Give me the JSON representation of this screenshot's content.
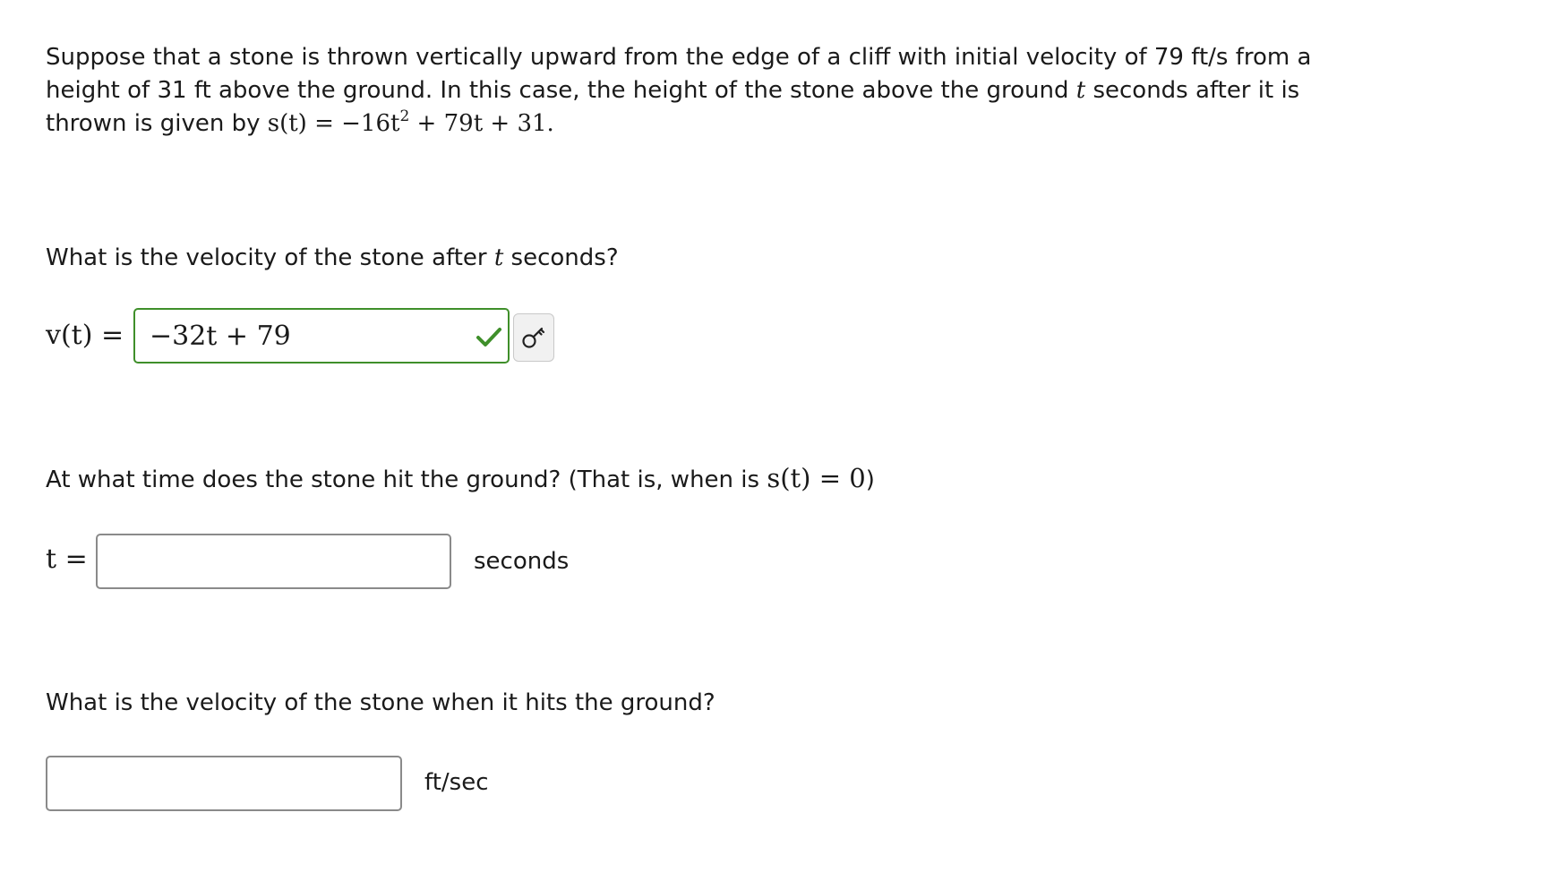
{
  "intro": {
    "text_part1": "Suppose that a stone is thrown vertically upward from the edge of a cliff with initial velocity of 79 ft/s from a height of 31 ft above the ground. In this case, the height of the stone above the ground ",
    "var_t": "t",
    "text_part2": " seconds after it is thrown is given by ",
    "formula_lhs": "s(t) = −16t",
    "formula_exp": "2",
    "formula_rhs": " + 79t + 31."
  },
  "question1": {
    "text_part1": "What is the velocity of the stone after ",
    "var_t": "t",
    "text_part2": " seconds?",
    "label": "v(t) =",
    "answer_value": "−32t + 79",
    "answer_status": "correct",
    "key_button_icon": "key-icon"
  },
  "question2": {
    "text_part1": "At what time does the stone hit the ground? (That is, when is ",
    "math": "s(t) = 0",
    "text_part2": ")",
    "label": "t =",
    "answer_value": "",
    "unit": "seconds"
  },
  "question3": {
    "text": "What is the velocity of the stone when it hits the ground?",
    "answer_value": "",
    "unit": "ft/sec"
  },
  "colors": {
    "correct_border": "#3f8f2a",
    "default_border": "#8a8a8a",
    "check": "#3f8f2a"
  }
}
